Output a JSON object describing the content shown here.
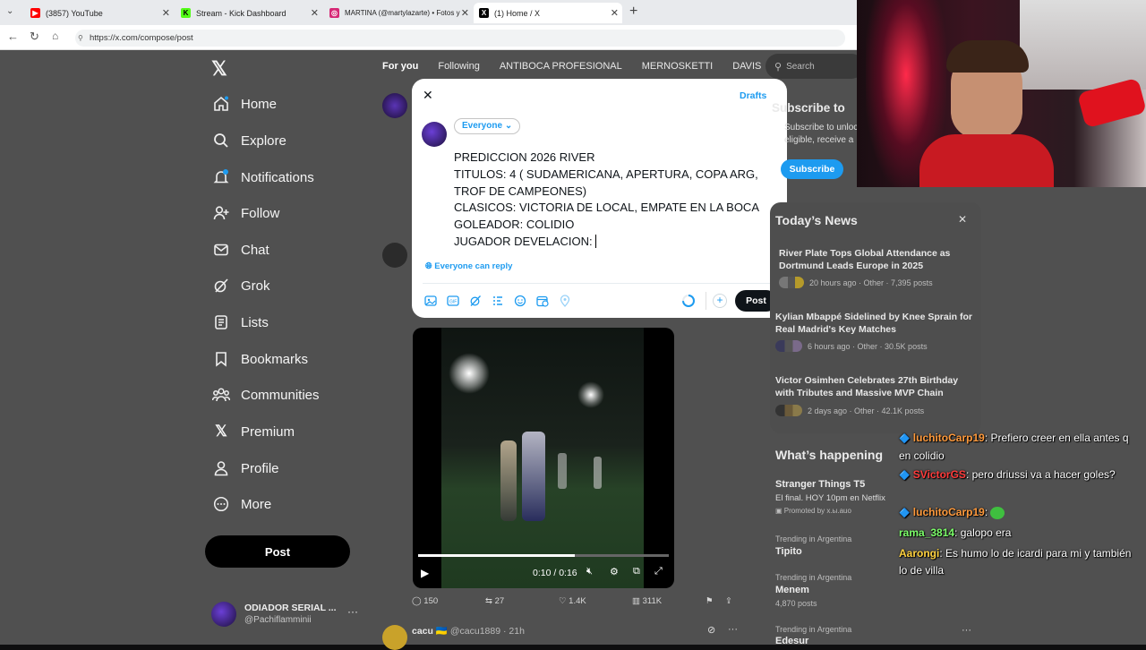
{
  "browser": {
    "tabs": [
      {
        "title": "(3857) YouTube",
        "color": "#ff0000",
        "letter": "▶"
      },
      {
        "title": "Stream - Kick Dashboard",
        "color": "#53fc18",
        "letter": "K"
      },
      {
        "title": "MARTINA (@martylazarte) • Fotos y",
        "color": "#d62976",
        "letter": "◎"
      },
      {
        "title": "(1) Home / X",
        "color": "#000000",
        "letter": "X"
      }
    ],
    "url": "https://x.com/compose/post"
  },
  "sidebar": {
    "items": [
      {
        "label": "Home",
        "icon": "home-icon"
      },
      {
        "label": "Explore",
        "icon": "search-icon"
      },
      {
        "label": "Notifications",
        "icon": "bell-icon"
      },
      {
        "label": "Follow",
        "icon": "person-plus-icon"
      },
      {
        "label": "Chat",
        "icon": "mail-icon"
      },
      {
        "label": "Grok",
        "icon": "grok-icon"
      },
      {
        "label": "Lists",
        "icon": "list-icon"
      },
      {
        "label": "Bookmarks",
        "icon": "bookmark-icon"
      },
      {
        "label": "Communities",
        "icon": "communities-icon"
      },
      {
        "label": "Premium",
        "icon": "x-logo-icon"
      },
      {
        "label": "Profile",
        "icon": "person-icon"
      },
      {
        "label": "More",
        "icon": "more-circle-icon"
      }
    ],
    "post_label": "Post",
    "account": {
      "name": "ODIADOR SERIAL ...",
      "handle": "@Pachiflamminii"
    }
  },
  "feed": {
    "tabs": [
      "For you",
      "Following",
      "ANTIBOCA PROFESIONAL",
      "MERNOSKETTI",
      "DAVIS"
    ],
    "search_placeholder": "Search",
    "video": {
      "time": "0:10 / 0:16"
    },
    "actions": {
      "replies": "150",
      "reposts": "27",
      "likes": "1.4K",
      "views": "311K"
    },
    "next_post": {
      "name": "cacu",
      "flag": "🇺🇦",
      "meta": "@cacu1889 · 21h"
    }
  },
  "compose": {
    "drafts_label": "Drafts",
    "audience_label": "Everyone",
    "reply_setting": "Everyone can reply",
    "post_label": "Post",
    "lines": [
      "PREDICCION 2026 RIVER",
      "TITULOS: 4 ( SUDAMERICANA, APERTURA, COPA ARG,",
      "TROF DE CAMPEONES)",
      "CLASICOS: VICTORIA DE LOCAL, EMPATE EN LA BOCA",
      "GOLEADOR: COLIDIO",
      "JUGADOR DEVELACION: "
    ]
  },
  "right": {
    "subscribe": {
      "title": "Subscribe to",
      "text1": "Subscribe to unloc",
      "text2": "eligible, receive a",
      "button": "Subscribe"
    },
    "news": {
      "title": "Today’s News",
      "items": [
        {
          "headline": "River Plate Tops Global Attendance as Dortmund Leads Europe in 2025",
          "meta": "20 hours ago · Other · 7,395 posts"
        },
        {
          "headline": "Kylian Mbappé Sidelined by Knee Sprain for Real Madrid's Key Matches",
          "meta": "6 hours ago · Other · 30.5K posts"
        },
        {
          "headline": "Victor Osimhen Celebrates 27th Birthday with Tributes and Massive MVP Chain",
          "meta": "2 days ago · Other · 42.1K posts"
        }
      ]
    },
    "happening": {
      "title": "What’s happening",
      "items": [
        {
          "title": "Stranger Things T5",
          "sub": "El final. HOY 10pm en Netflix",
          "promo": "Promoted by x.ы.auo"
        },
        {
          "context": "Trending in Argentina",
          "title": "Tipito",
          "count": ""
        },
        {
          "context": "Trending in Argentina",
          "title": "Menem",
          "count": "4,870 posts"
        },
        {
          "context": "Trending in Argentina",
          "title": "Edesur",
          "count": ""
        }
      ]
    }
  },
  "chat": [
    {
      "user": "luchitoCarp19",
      "color": "#ff9a3c",
      "text": ": Prefiero creer en ella antes q en colidio"
    },
    {
      "user": "SVictorGS",
      "color": "#ff3b3b",
      "text": ": pero driussi va a hacer goles?"
    },
    {
      "user": "luchitoCarp19",
      "color": "#ff9a3c",
      "text": ": "
    },
    {
      "user": "rama_3814",
      "color": "#7cff6a",
      "text": ": galopo era"
    },
    {
      "user": "Aarongi",
      "color": "#ffd23f",
      "text": ": Es humo lo de icardi para mi y también lo de villa"
    }
  ]
}
